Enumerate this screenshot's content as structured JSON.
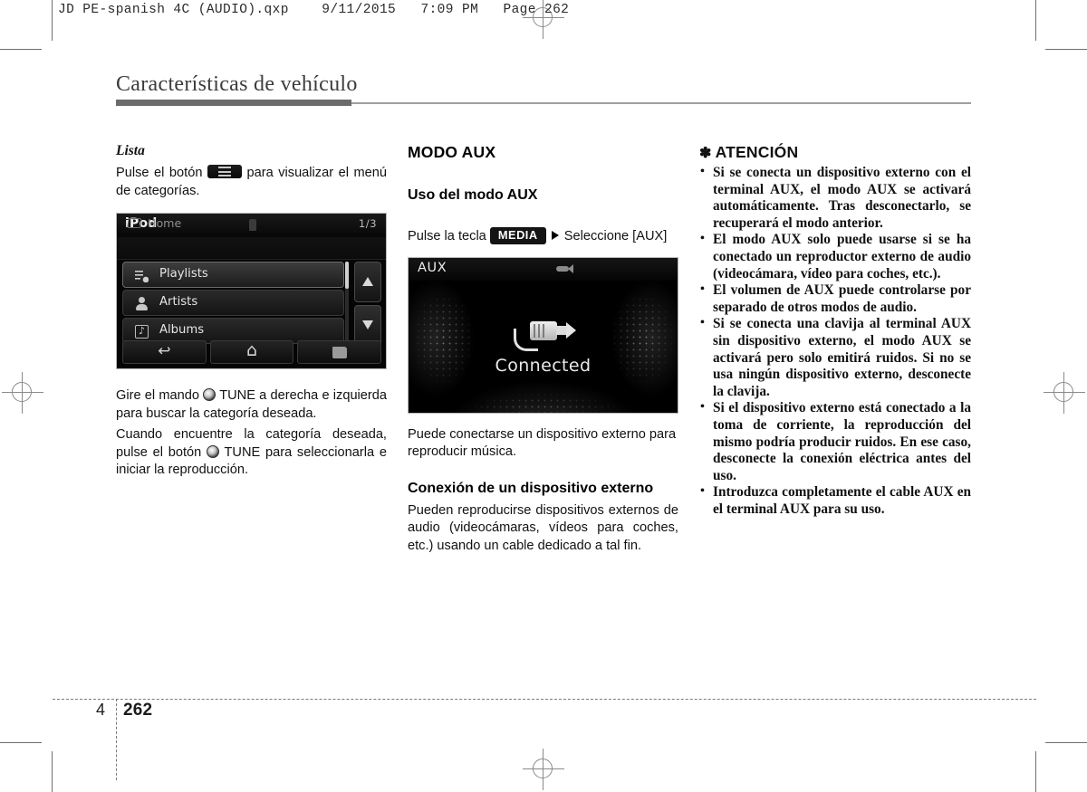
{
  "print": {
    "running_header": "JD PE-spanish 4C (AUDIO).qxp    9/11/2015   7:09 PM   Page 262"
  },
  "chapter": {
    "title": "Características de vehículo",
    "number": "4",
    "page_number": "262"
  },
  "col_left": {
    "subhead": "Lista",
    "para_1_before": "Pulse el botón",
    "para_1_after": "para visualizar el menú de categorías.",
    "menu_icon": "list-menu-icon",
    "para_2_a": "Gire el mando",
    "para_2_b": "TUNE a derecha e izquierda para buscar la categoría deseada.",
    "para_3_a": "Cuando encuentre la categoría deseada, pulse el botón",
    "para_3_b": "TUNE para seleccionarla e iniciar la reproducción."
  },
  "ipod_screen": {
    "title": "iPod",
    "path_label": "Home",
    "page_indicator": "1/3",
    "rows": [
      {
        "label": "Playlists",
        "icon": "playlist-icon",
        "selected": true
      },
      {
        "label": "Artists",
        "icon": "artist-icon",
        "selected": false
      },
      {
        "label": "Albums",
        "icon": "album-icon",
        "selected": false
      }
    ],
    "softkeys": [
      {
        "name": "back-button",
        "icon": "back-arrow-icon"
      },
      {
        "name": "home-button",
        "icon": "home-icon"
      },
      {
        "name": "up-folder-button",
        "icon": "folder-up-icon"
      }
    ],
    "scroll_up": "scroll-up-arrow",
    "scroll_down": "scroll-down-arrow"
  },
  "col_mid": {
    "head": "MODO AUX",
    "subhead": "Uso del modo AUX",
    "instr_a": "Pulse la tecla",
    "instr_key": "MEDIA",
    "instr_b": "Seleccione [AUX]",
    "caption": "Puede conectarse un dispositivo externo para reproducir música.",
    "subhead_2": "Conexión de un dispositivo externo",
    "para": "Pueden reproducirse dispositivos externos de audio (videocámaras, vídeos para coches, etc.) usando un cable dedicado a tal fin."
  },
  "aux_screen": {
    "title": "AUX",
    "status": "Connected",
    "top_icon": "aux-plug-icon",
    "center_icon": "plug-cable-icon"
  },
  "caution": {
    "star": "✽",
    "title": "ATENCIÓN",
    "items": [
      "Si se conecta un dispositivo externo con el terminal AUX, el modo AUX se activará automáticamente. Tras desconectarlo, se recuperará el modo anterior.",
      "El modo AUX solo puede usarse si se ha conectado un reproductor externo de audio (videocámara, vídeo para coches, etc.).",
      "El volumen de AUX puede controlarse por separado de otros modos de audio.",
      "Si se conecta una clavija al terminal AUX sin dispositivo externo, el modo AUX se activará pero solo emitirá ruidos. Si no se usa ningún dispositivo externo, desconecte la clavija.",
      "Si el dispositivo externo está conectado a la toma de corriente, la reproducción del mismo podría producir ruidos. En ese caso, desconecte la conexión eléctrica antes del uso.",
      "Introduzca completamente el cable AUX en el terminal AUX para su uso."
    ]
  },
  "colors": {
    "title_rule_dark": "#6b6b6b",
    "title_rule_light": "#9f9f9f",
    "text": "#111111",
    "mark": "#8a8a8a"
  }
}
